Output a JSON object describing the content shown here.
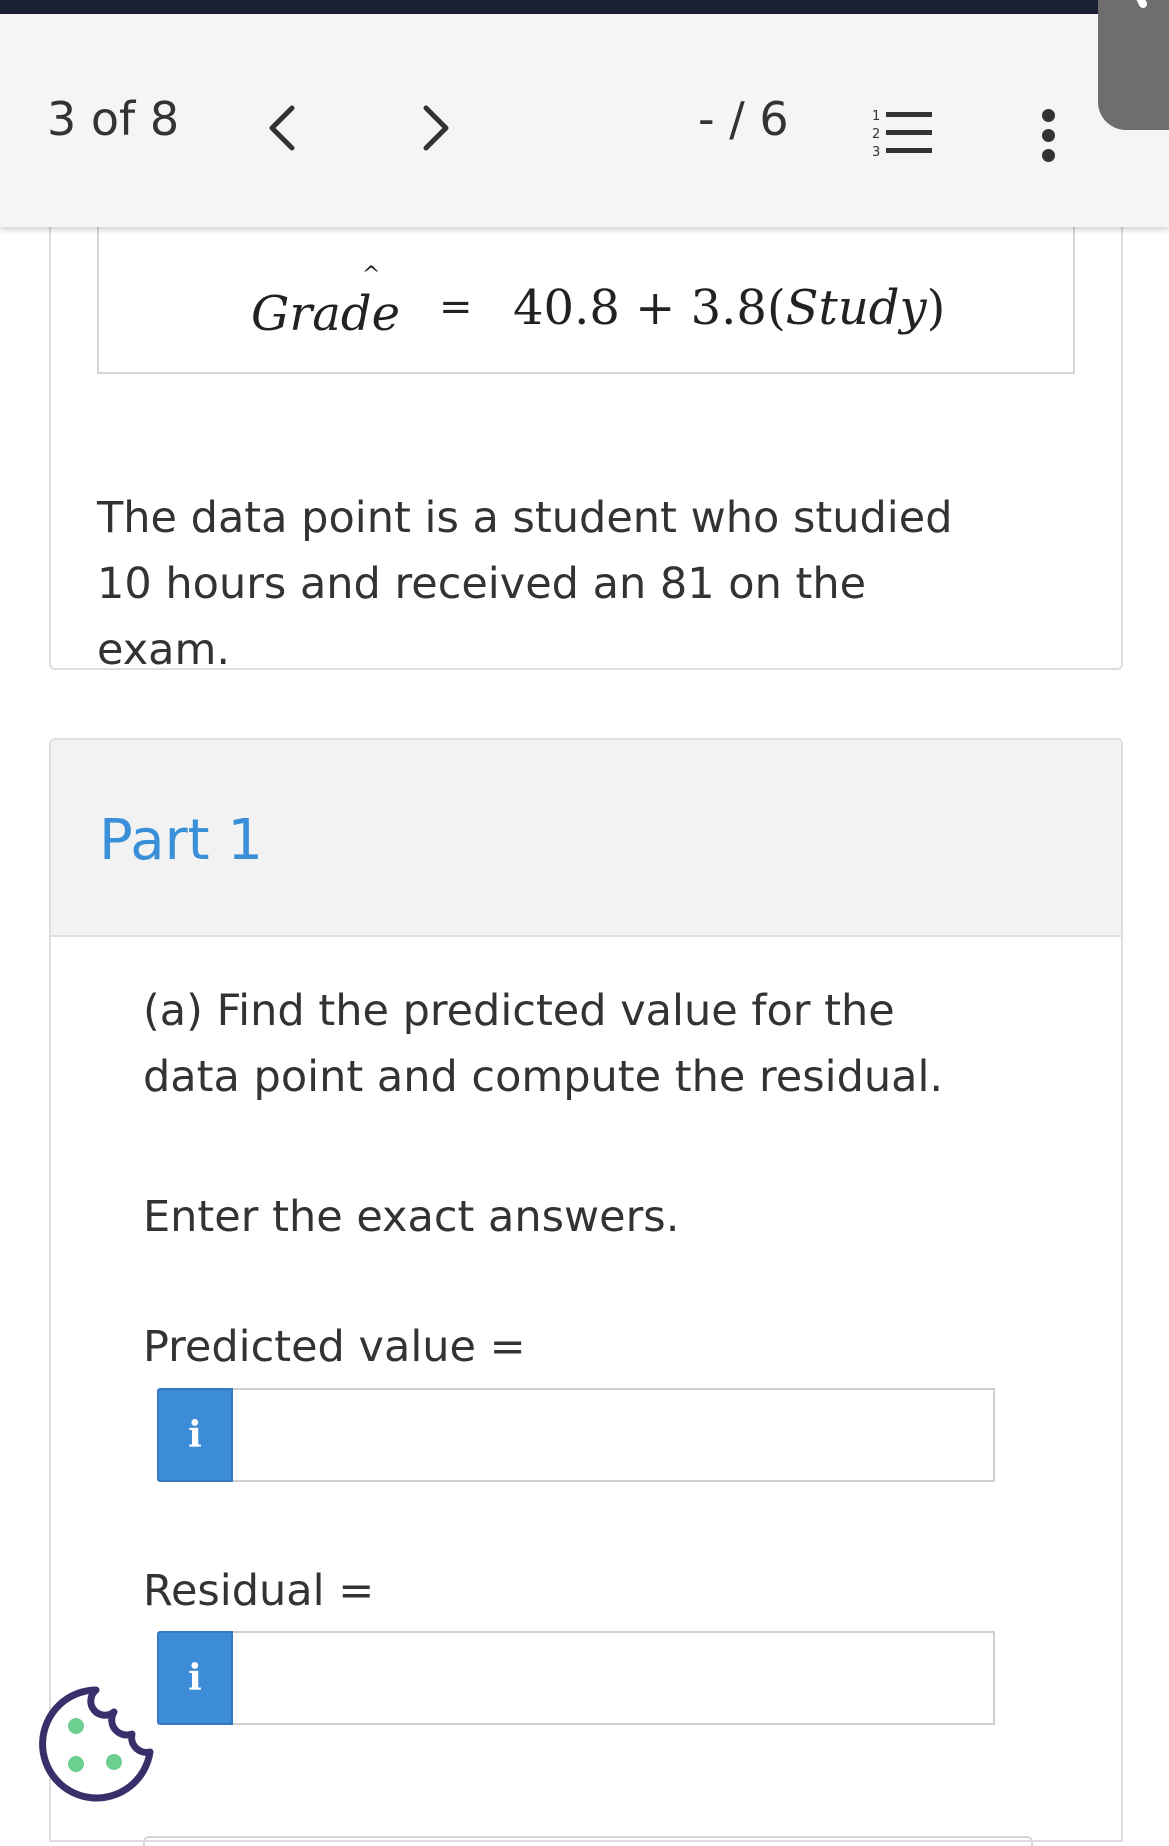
{
  "toolbar": {
    "question_counter": "3 of 8",
    "prev_icon": "chevron-left-icon",
    "next_icon": "chevron-right-icon",
    "score": "- / 6",
    "list_icon": "numbered-list-icon",
    "more_icon": "more-vertical-icon"
  },
  "question": {
    "equation": {
      "lhs": "Grade",
      "hat": "^",
      "equals": "=",
      "rhs_prefix": "40.8 + 3.8(",
      "rhs_variable": "Study",
      "rhs_suffix": ")"
    },
    "description": "The data point is a student who studied 10 hours and received an 81 on the exam."
  },
  "part": {
    "title": "Part 1",
    "prompt": "(a) Find the predicted value for the data point and compute the residual.",
    "instruction": "Enter the exact answers.",
    "fields": [
      {
        "label": "Predicted value =",
        "info_label": "i",
        "value": ""
      },
      {
        "label": "Residual =",
        "info_label": "i",
        "value": ""
      }
    ]
  },
  "colors": {
    "top_strip": "#1a2135",
    "accent_blue": "#3d8cd8",
    "part_title_blue": "#3a8fd9",
    "cookie_outline": "#3b2f6b",
    "cookie_dots": "#6ccf8f"
  }
}
